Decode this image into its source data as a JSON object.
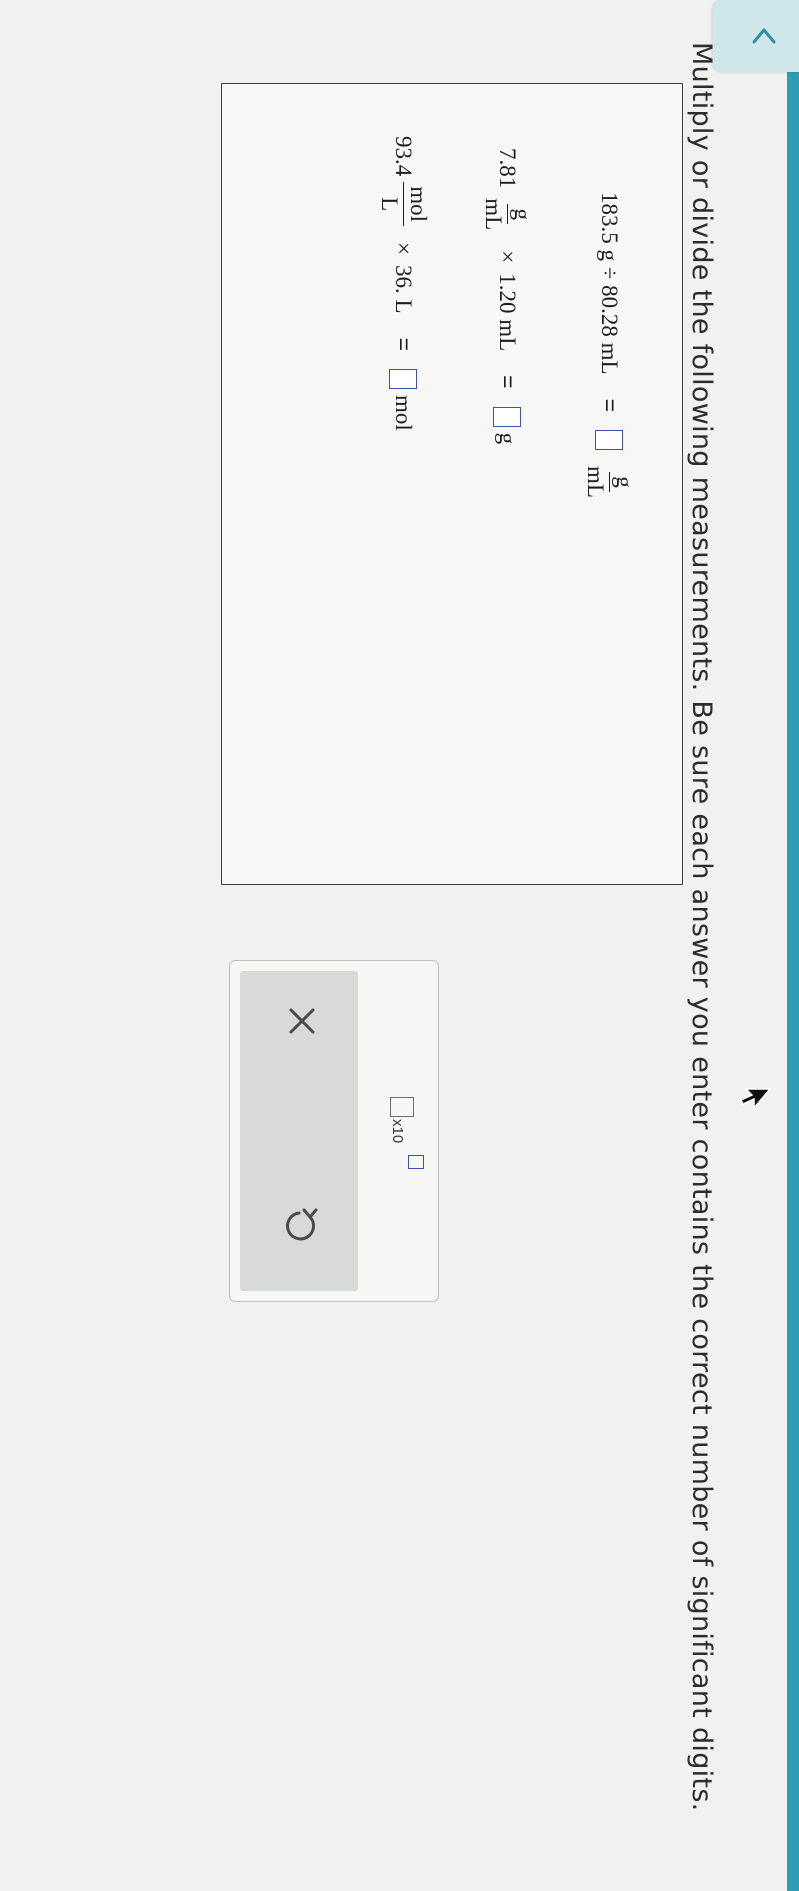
{
  "instruction": "Multiply or divide the following measurements. Be sure each answer you enter contains the correct number of significant digits.",
  "problems": [
    {
      "left_text": "183.5 g ÷ 80.28 mL",
      "equals": "=",
      "answer_value": "",
      "unit_num": "g",
      "unit_den": "mL"
    },
    {
      "coef": "7.81",
      "frac_num": "g",
      "frac_den": "mL",
      "operator": "×",
      "operand": "1.20 mL",
      "equals": "=",
      "answer_value": "",
      "unit": "g"
    },
    {
      "coef": "93.4",
      "frac_num": "mol",
      "frac_den": "L",
      "operator": "×",
      "operand": "36. L",
      "equals": "=",
      "answer_value": "",
      "unit": "mol"
    }
  ],
  "toolbox": {
    "sci_label": "x10",
    "clear_icon": "close-icon",
    "undo_icon": "undo-icon"
  },
  "colors": {
    "topbar": "#2f9db1",
    "answer_box_border": "#3f51b5"
  }
}
